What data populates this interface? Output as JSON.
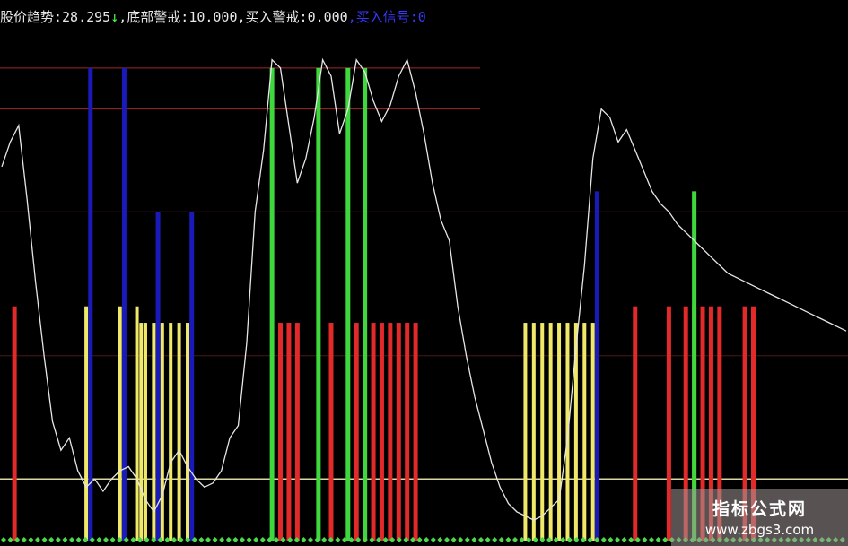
{
  "readout": {
    "trend_label": "股价趋势:",
    "trend_value": "28.295",
    "trend_arrow": "↓",
    "bottom_label": ",底部警戒:",
    "bottom_value": "10.000",
    "buy_warn_label": ",买入警戒:",
    "buy_warn_value": "0.000",
    "buy_signal_label": ",买入信号:",
    "buy_signal_value": "0"
  },
  "watermark": {
    "title": "指标公式网",
    "url": "www.zbgs3.com"
  },
  "colors": {
    "background": "#000000",
    "trend_line": "#e6e6e6",
    "red_bar": "#e22a2a",
    "yellow_bar": "#f0e868",
    "green_bar": "#3ed83e",
    "blue_bar": "#1a1ab8",
    "reference_line_red": "#a02a2a",
    "reference_line_dim": "#4a1818",
    "baseline": "#d8d8a0",
    "marker": "#4cd84c"
  },
  "chart_data": {
    "type": "line",
    "ylim": [
      -5,
      120
    ],
    "reference_lines": [
      {
        "y": 110,
        "color": "red"
      },
      {
        "y": 100,
        "color": "red"
      },
      {
        "y": 75,
        "color": "dim"
      },
      {
        "y": 40,
        "color": "dim"
      },
      {
        "y": 10,
        "color": "baseline"
      }
    ],
    "trend": {
      "x": [
        0,
        2,
        4,
        6,
        8,
        10,
        12,
        14,
        16,
        18,
        20,
        22,
        24,
        26,
        28,
        30,
        32,
        34,
        36,
        38,
        40,
        42,
        44,
        46,
        48,
        50,
        52,
        54,
        56,
        58,
        60,
        62,
        64,
        66,
        68,
        70,
        72,
        74,
        76,
        78,
        80,
        82,
        84,
        86,
        88,
        90,
        92,
        94,
        96,
        98,
        100,
        102,
        104,
        106,
        108,
        110,
        112,
        114,
        116,
        118,
        120,
        122,
        124,
        126,
        128,
        130,
        132,
        134,
        136,
        138,
        140,
        142,
        144,
        146,
        148,
        150,
        152,
        154,
        156,
        158,
        160,
        162,
        164,
        166,
        168,
        170,
        172,
        174,
        176,
        178,
        180,
        182,
        184,
        186,
        188,
        190,
        192,
        194,
        196,
        198,
        200
      ],
      "y": [
        86,
        92,
        96,
        78,
        58,
        40,
        24,
        17,
        20,
        12,
        8,
        10,
        7,
        10,
        12,
        13,
        10,
        5,
        2,
        6,
        14,
        17,
        13,
        10,
        8,
        9,
        12,
        20,
        23,
        43,
        75,
        90,
        112,
        110,
        96,
        82,
        88,
        98,
        112,
        108,
        94,
        100,
        112,
        109,
        102,
        97,
        101,
        108,
        112,
        104,
        94,
        82,
        73,
        68,
        52,
        40,
        30,
        22,
        14,
        8,
        4,
        2,
        1,
        0,
        1,
        3,
        5,
        20,
        42,
        62,
        88,
        100,
        98,
        92,
        95,
        90,
        85,
        80,
        77,
        75,
        72,
        70,
        68,
        66,
        64,
        62,
        60,
        59,
        58,
        57,
        56,
        55,
        54,
        53,
        52,
        51,
        50,
        49,
        48,
        47,
        46
      ]
    },
    "bars": {
      "red_x": [
        3,
        66,
        68,
        70,
        78,
        84,
        86,
        88,
        90,
        92,
        94,
        96,
        98,
        150,
        158,
        162,
        164,
        166,
        168,
        170,
        176,
        178
      ],
      "red_height": [
        52,
        48,
        48,
        48,
        48,
        48,
        48,
        48,
        48,
        48,
        48,
        48,
        48,
        52,
        52,
        52,
        52,
        52,
        52,
        52,
        52,
        52
      ],
      "yellow_x": [
        20,
        28,
        32,
        33,
        34,
        36,
        38,
        40,
        42,
        44,
        124,
        126,
        128,
        130,
        132,
        134,
        136,
        138,
        140
      ],
      "yellow_height": [
        52,
        52,
        52,
        48,
        48,
        48,
        48,
        48,
        48,
        48,
        48,
        48,
        48,
        48,
        48,
        48,
        48,
        48,
        48
      ],
      "green_x": [
        64,
        75,
        82,
        86,
        164
      ],
      "green_height": [
        110,
        110,
        110,
        110,
        80
      ],
      "blue_x": [
        21,
        29,
        37,
        45,
        141
      ],
      "blue_height": [
        110,
        110,
        75,
        75,
        80
      ]
    }
  }
}
